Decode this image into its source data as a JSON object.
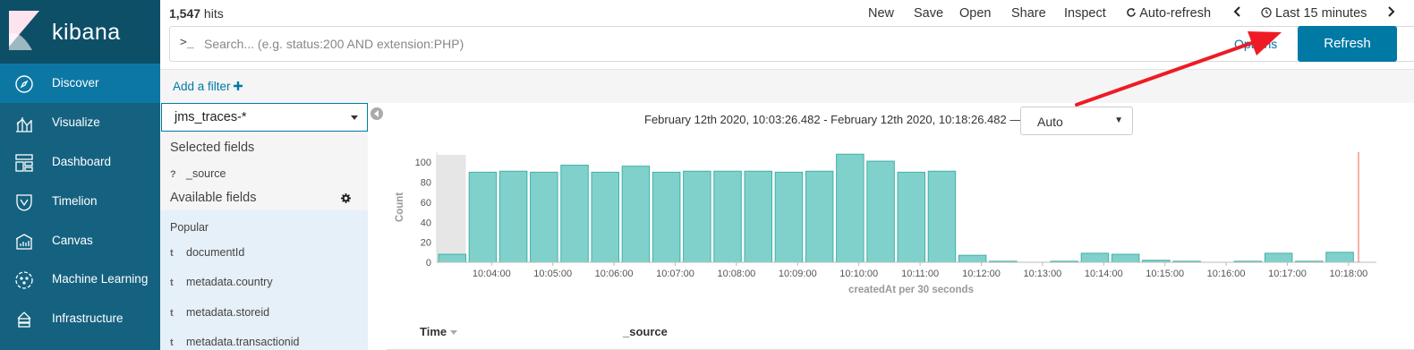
{
  "app": {
    "brand": "kibana"
  },
  "sidebar": {
    "items": [
      {
        "label": "Discover",
        "icon": "compass-icon",
        "active": true
      },
      {
        "label": "Visualize",
        "icon": "visualize-icon",
        "active": false
      },
      {
        "label": "Dashboard",
        "icon": "dashboard-icon",
        "active": false
      },
      {
        "label": "Timelion",
        "icon": "timelion-icon",
        "active": false
      },
      {
        "label": "Canvas",
        "icon": "canvas-icon",
        "active": false
      },
      {
        "label": "Machine Learning",
        "icon": "machine-learning-icon",
        "active": false
      },
      {
        "label": "Infrastructure",
        "icon": "infrastructure-icon",
        "active": false
      }
    ]
  },
  "topbar": {
    "hits_count": "1,547",
    "hits_suffix": " hits",
    "menu": [
      "New",
      "Save",
      "Open",
      "Share",
      "Inspect"
    ],
    "auto_refresh": "Auto-refresh",
    "time_range": "Last 15 minutes",
    "search_prompt": ">_",
    "search_placeholder": "Search... (e.g. status:200 AND extension:PHP)",
    "options_label": "Options",
    "refresh_label": "Refresh"
  },
  "filterbar": {
    "add_filter": "Add a filter"
  },
  "fields": {
    "index_pattern": "jms_traces-*",
    "selected_heading": "Selected fields",
    "selected": [
      {
        "type": "?",
        "name": "_source"
      }
    ],
    "available_heading": "Available fields",
    "popular_heading": "Popular",
    "popular": [
      {
        "type": "t",
        "name": "documentId"
      },
      {
        "type": "t",
        "name": "metadata.country"
      },
      {
        "type": "t",
        "name": "metadata.storeid"
      },
      {
        "type": "t",
        "name": "metadata.transactionid"
      }
    ]
  },
  "histogram": {
    "range_text": "February 12th 2020, 10:03:26.482 - February 12th 2020, 10:18:26.482 —",
    "interval": "Auto"
  },
  "table": {
    "columns": [
      "Time",
      "_source"
    ]
  },
  "chart_data": {
    "type": "bar",
    "xlabel": "createdAt per 30 seconds",
    "ylabel": "Count",
    "ylim": [
      0,
      110
    ],
    "yticks": [
      0,
      20,
      40,
      60,
      80,
      100
    ],
    "xticks": [
      "10:04:00",
      "10:05:00",
      "10:06:00",
      "10:07:00",
      "10:08:00",
      "10:09:00",
      "10:10:00",
      "10:11:00",
      "10:12:00",
      "10:13:00",
      "10:14:00",
      "10:15:00",
      "10:16:00",
      "10:17:00",
      "10:18:00"
    ],
    "values": [
      8,
      90,
      91,
      90,
      97,
      90,
      96,
      90,
      91,
      91,
      91,
      90,
      91,
      108,
      101,
      90,
      91,
      7,
      1,
      0,
      1,
      9,
      8,
      2,
      1,
      0,
      1,
      9,
      1,
      10,
      0
    ],
    "bar_color": "#80d1cb",
    "bar_stroke": "#3fb1a7",
    "partial_bucket_color": "#e6e6e6"
  }
}
